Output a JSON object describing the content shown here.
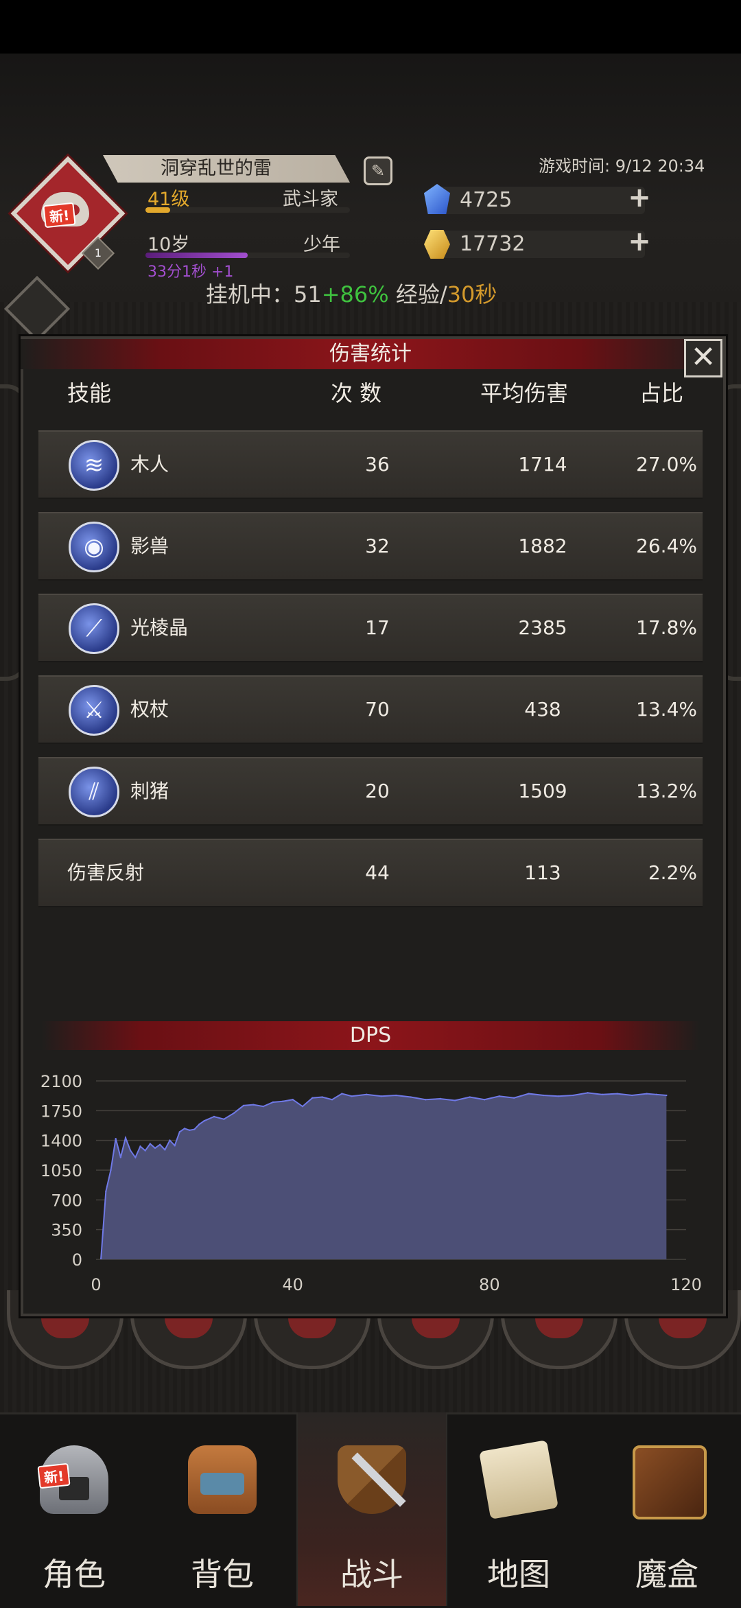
{
  "header": {
    "new_badge": "新!",
    "avatar_level": "1",
    "player_name": "洞穿乱世的雷",
    "level_text": "41级",
    "class_text": "武斗家",
    "age_text": "10岁",
    "age_stage": "少年",
    "age_timer": "33分1秒 +1",
    "game_time": "游戏时间: 9/12 20:34",
    "blue_gem_value": "4725",
    "gold_gem_value": "17732",
    "afk_prefix": "挂机中：51",
    "afk_bonus": "+86%",
    "afk_mid": " 经验/",
    "afk_time": "30秒",
    "colors": {
      "afk_bonus": "#3fc23f",
      "afk_time": "#d49a2c",
      "level": "#e2a82c",
      "age_timer": "#a34fd0"
    }
  },
  "modal": {
    "title": "伤害统计",
    "close_label": "✕",
    "columns": {
      "skill": "技能",
      "count": "次 数",
      "avg": "平均伤害",
      "pct": "占比"
    },
    "rows": [
      {
        "icon": "slash-skill-icon",
        "glyph": "≋",
        "name": "木人",
        "count": "36",
        "avg": "1714",
        "pct": "27.0%"
      },
      {
        "icon": "beast-skill-icon",
        "glyph": "◉",
        "name": "影兽",
        "count": "32",
        "avg": "1882",
        "pct": "26.4%"
      },
      {
        "icon": "crystal-skill-icon",
        "glyph": "⟋",
        "name": "光棱晶",
        "count": "17",
        "avg": "2385",
        "pct": "17.8%"
      },
      {
        "icon": "scepter-skill-icon",
        "glyph": "⚔",
        "name": "权杖",
        "count": "70",
        "avg": "438",
        "pct": "13.4%"
      },
      {
        "icon": "spike-skill-icon",
        "glyph": "⫽",
        "name": "刺猪",
        "count": "20",
        "avg": "1509",
        "pct": "13.2%"
      },
      {
        "icon": "",
        "glyph": "",
        "name": "伤害反射",
        "count": "44",
        "avg": "113",
        "pct": "2.2%"
      }
    ],
    "dps_title": "DPS"
  },
  "chart_data": {
    "type": "area",
    "title": "DPS",
    "xlim": [
      0,
      120
    ],
    "ylim": [
      0,
      2100
    ],
    "xticks": [
      0,
      40,
      80,
      120
    ],
    "yticks": [
      0,
      350,
      700,
      1050,
      1400,
      1750,
      2100
    ],
    "grid": true,
    "fill_color": "#4c4f76",
    "line_color": "#6f79e6",
    "x": [
      1,
      2,
      3,
      4,
      5,
      6,
      7,
      8,
      9,
      10,
      11,
      12,
      13,
      14,
      15,
      16,
      17,
      18,
      19,
      20,
      21,
      22,
      24,
      26,
      28,
      30,
      32,
      34,
      36,
      38,
      40,
      42,
      44,
      46,
      48,
      50,
      52,
      55,
      58,
      61,
      64,
      67,
      70,
      73,
      76,
      79,
      82,
      85,
      88,
      91,
      94,
      97,
      100,
      103,
      106,
      109,
      112,
      114,
      116
    ],
    "y": [
      10,
      800,
      1050,
      1420,
      1200,
      1430,
      1280,
      1200,
      1330,
      1280,
      1360,
      1310,
      1350,
      1290,
      1400,
      1340,
      1500,
      1540,
      1520,
      1530,
      1590,
      1630,
      1680,
      1650,
      1720,
      1810,
      1820,
      1800,
      1850,
      1860,
      1880,
      1800,
      1900,
      1910,
      1880,
      1950,
      1920,
      1940,
      1920,
      1930,
      1910,
      1880,
      1890,
      1870,
      1910,
      1880,
      1920,
      1900,
      1950,
      1930,
      1920,
      1930,
      1960,
      1940,
      1950,
      1930,
      1950,
      1940,
      1930
    ]
  },
  "nav": {
    "items": [
      {
        "label": "角色",
        "icon": "helmet-icon",
        "badge": "新!"
      },
      {
        "label": "背包",
        "icon": "backpack-icon",
        "badge": ""
      },
      {
        "label": "战斗",
        "icon": "sword-shield-icon",
        "badge": ""
      },
      {
        "label": "地图",
        "icon": "scroll-map-icon",
        "badge": ""
      },
      {
        "label": "魔盒",
        "icon": "magic-box-icon",
        "badge": ""
      }
    ],
    "active": "战斗"
  }
}
